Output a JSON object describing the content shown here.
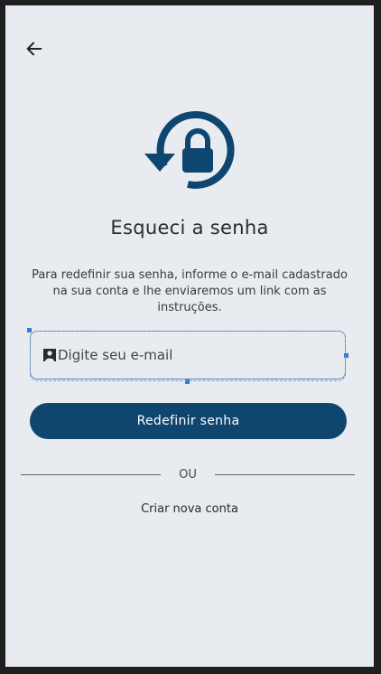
{
  "header": {
    "back_icon": "arrow-left-icon"
  },
  "hero": {
    "icon": "lock-reset-icon",
    "color": "#0f4670"
  },
  "title": "Esqueci a senha",
  "description": "Para redefinir sua senha, informe o e-mail cadastrado na sua conta e lhe enviaremos um link com as instruções.",
  "email_field": {
    "placeholder": "Digite seu e-mail",
    "value": "",
    "icon": "person-icon",
    "focus_color": "#2e7cd6"
  },
  "primary_button": {
    "label": "Redefinir senha",
    "color": "#0f4670"
  },
  "divider": {
    "label": "OU"
  },
  "secondary_link": {
    "label": "Criar nova conta"
  },
  "colors": {
    "background": "#e8ecf0",
    "text": "#2a2a2a"
  }
}
